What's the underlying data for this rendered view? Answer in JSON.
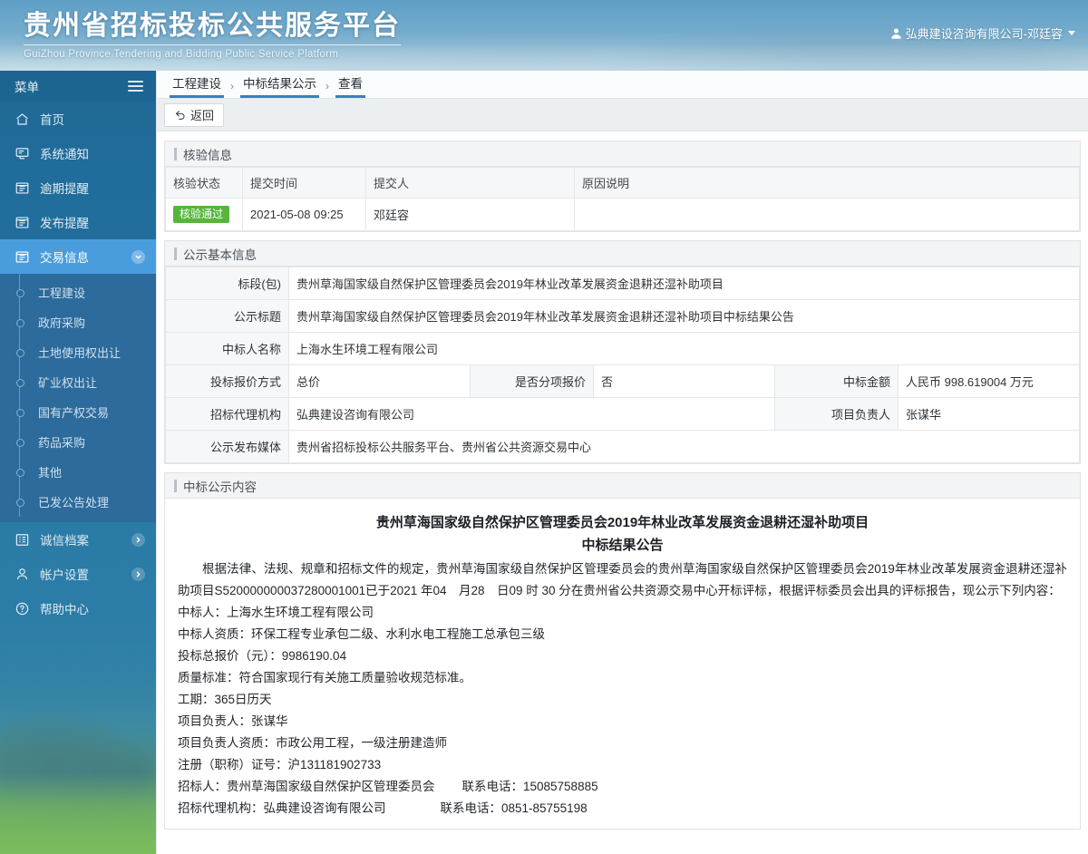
{
  "header": {
    "title_cn": "贵州省招标投标公共服务平台",
    "title_en": "GuiZhou Province Tendering and Bidding Public Service Platform",
    "user": "弘典建设咨询有限公司-邓廷容"
  },
  "sidebar": {
    "menu_label": "菜单",
    "items": [
      {
        "label": "首页",
        "icon": "home-icon",
        "active": false
      },
      {
        "label": "系统通知",
        "icon": "monitor-icon",
        "active": false
      },
      {
        "label": "逾期提醒",
        "icon": "list-box-icon",
        "active": false
      },
      {
        "label": "发布提醒",
        "icon": "list-box-icon",
        "active": false
      },
      {
        "label": "交易信息",
        "icon": "list-box-icon",
        "active": true,
        "arrow": "chevron-down-icon"
      }
    ],
    "submenu": [
      {
        "label": "工程建设"
      },
      {
        "label": "政府采购"
      },
      {
        "label": "土地使用权出让"
      },
      {
        "label": "矿业权出让"
      },
      {
        "label": "国有产权交易"
      },
      {
        "label": "药品采购"
      },
      {
        "label": "其他"
      },
      {
        "label": "已发公告处理"
      }
    ],
    "bottom_items": [
      {
        "label": "诚信档案",
        "icon": "archive-icon",
        "arrow": "chevron-right-icon"
      },
      {
        "label": "帐户设置",
        "icon": "user-icon",
        "arrow": "chevron-right-icon"
      },
      {
        "label": "帮助中心",
        "icon": "question-circle-icon",
        "arrow": ""
      }
    ]
  },
  "breadcrumb": [
    "工程建设",
    "中标结果公示",
    "查看"
  ],
  "breadcrumb_sep": "›",
  "toolbar": {
    "back_label": "返回"
  },
  "verify_panel": {
    "title": "核验信息",
    "columns": [
      "核验状态",
      "提交时间",
      "提交人",
      "原因说明"
    ],
    "rows": [
      {
        "status": "核验通过",
        "time": "2021-05-08 09:25",
        "person": "邓廷容",
        "reason": ""
      }
    ]
  },
  "basic_panel": {
    "title": "公示基本信息",
    "fields": {
      "section_label": "标段(包)",
      "section_value": "贵州草海国家级自然保护区管理委员会2019年林业改革发展资金退耕还湿补助项目",
      "notice_title_label": "公示标题",
      "notice_title_value": "贵州草海国家级自然保护区管理委员会2019年林业改革发展资金退耕还湿补助项目中标结果公告",
      "winner_label": "中标人名称",
      "winner_value": "上海水生环境工程有限公司",
      "quote_mode_label": "投标报价方式",
      "quote_mode_value": "总价",
      "itemized_label": "是否分项报价",
      "itemized_value": "否",
      "amount_label": "中标金额",
      "amount_value": "人民币 998.619004 万元",
      "agency_label": "招标代理机构",
      "agency_value": "弘典建设咨询有限公司",
      "manager_label": "项目负责人",
      "manager_value": "张谋华",
      "media_label": "公示发布媒体",
      "media_value": "贵州省招标投标公共服务平台、贵州省公共资源交易中心"
    }
  },
  "content_panel": {
    "title": "中标公示内容",
    "doc_title": "贵州草海国家级自然保护区管理委员会2019年林业改革发展资金退耕还湿补助项目",
    "doc_subtitle": "中标结果公告",
    "paragraph": "根据法律、法规、规章和招标文件的规定，贵州草海国家级自然保护区管理委员会的贵州草海国家级自然保护区管理委员会2019年林业改革发展资金退耕还湿补助项目S520000000037280001001已于2021 年04　月28　日09 时 30 分在贵州省公共资源交易中心开标评标，根据评标委员会出具的评标报告，现公示下列内容：",
    "lines": [
      "中标人：上海水生环境工程有限公司",
      "中标人资质：环保工程专业承包二级、水利水电工程施工总承包三级",
      "投标总报价（元）：9986190.04",
      "质量标准：符合国家现行有关施工质量验收规范标准。",
      "工期：365日历天",
      "项目负责人：张谋华",
      "项目负责人资质：市政公用工程，一级注册建造师",
      "注册（职称）证号：沪131181902733",
      "招标人：贵州草海国家级自然保护区管理委员会        联系电话：15085758885",
      "招标代理机构：弘典建设咨询有限公司                联系电话：0851-85755198"
    ]
  }
}
